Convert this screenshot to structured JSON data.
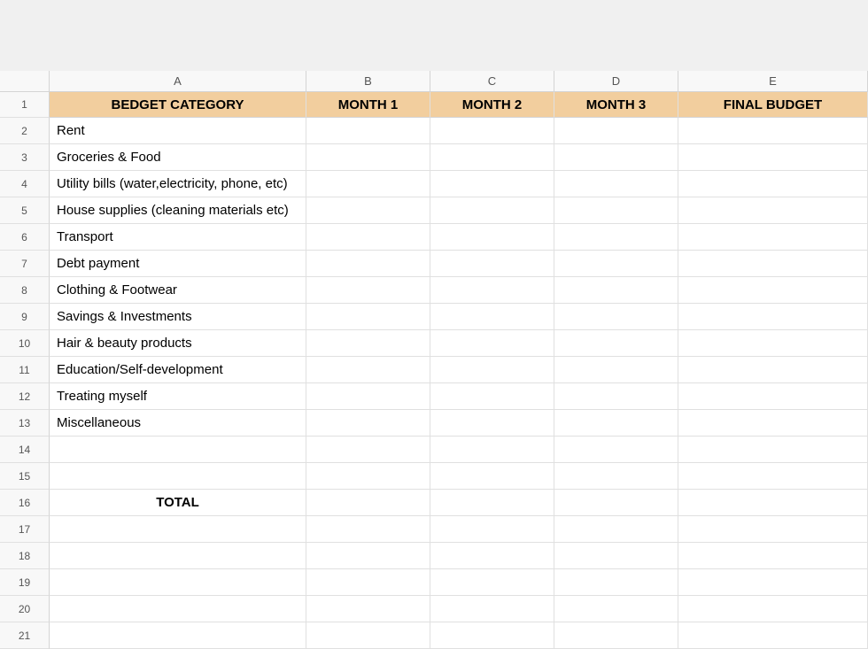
{
  "columns": [
    "A",
    "B",
    "C",
    "D",
    "E"
  ],
  "headerRow": {
    "A": "BEDGET CATEGORY",
    "B": "MONTH 1",
    "C": "MONTH 2",
    "D": "MONTH 3",
    "E": "FINAL BUDGET"
  },
  "rows": [
    {
      "num": "1"
    },
    {
      "num": "2",
      "A": "Rent"
    },
    {
      "num": "3",
      "A": "Groceries & Food"
    },
    {
      "num": "4",
      "A": "Utility bills (water,electricity, phone, etc)"
    },
    {
      "num": "5",
      "A": "House supplies (cleaning materials etc)"
    },
    {
      "num": "6",
      "A": "Transport"
    },
    {
      "num": "7",
      "A": "Debt payment"
    },
    {
      "num": "8",
      "A": "Clothing & Footwear"
    },
    {
      "num": "9",
      "A": "Savings & Investments"
    },
    {
      "num": "10",
      "A": "Hair & beauty products"
    },
    {
      "num": "11",
      "A": "Education/Self-development"
    },
    {
      "num": "12",
      "A": "Treating myself"
    },
    {
      "num": "13",
      "A": "Miscellaneous"
    },
    {
      "num": "14",
      "A": ""
    },
    {
      "num": "15",
      "A": ""
    },
    {
      "num": "16",
      "A": "TOTAL",
      "bold": true
    },
    {
      "num": "17",
      "A": ""
    },
    {
      "num": "18",
      "A": ""
    },
    {
      "num": "19",
      "A": ""
    },
    {
      "num": "20",
      "A": ""
    },
    {
      "num": "21",
      "A": ""
    }
  ]
}
